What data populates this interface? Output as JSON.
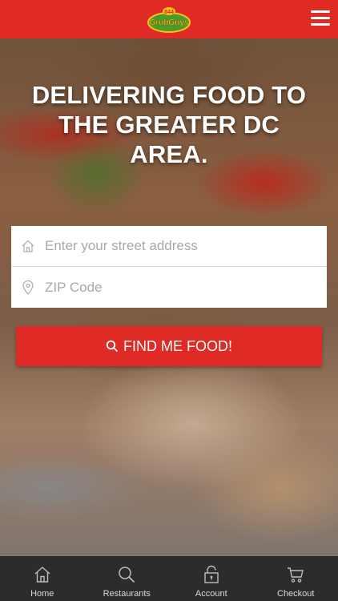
{
  "header": {
    "logo": {
      "top_text": "844",
      "main_text": "GrubGuys"
    },
    "menu_icon": "hamburger-menu-icon"
  },
  "hero": {
    "headline": "DELIVERING FOOD TO THE GREATER DC AREA."
  },
  "form": {
    "address_placeholder": "Enter your street address",
    "zip_placeholder": "ZIP Code",
    "address_icon": "house-icon",
    "zip_icon": "location-pin-icon"
  },
  "find_button": {
    "label": "FIND ME FOOD!",
    "icon": "search-icon"
  },
  "tabbar": {
    "items": [
      {
        "label": "Home",
        "icon": "home-icon"
      },
      {
        "label": "Restaurants",
        "icon": "search-icon"
      },
      {
        "label": "Account",
        "icon": "lock-icon"
      },
      {
        "label": "Checkout",
        "icon": "cart-icon"
      }
    ]
  },
  "colors": {
    "brand_red": "#e02a25",
    "tabbar_bg": "#2c2c2c",
    "logo_green": "#4c9a2a",
    "logo_yellow": "#f5c21b"
  }
}
